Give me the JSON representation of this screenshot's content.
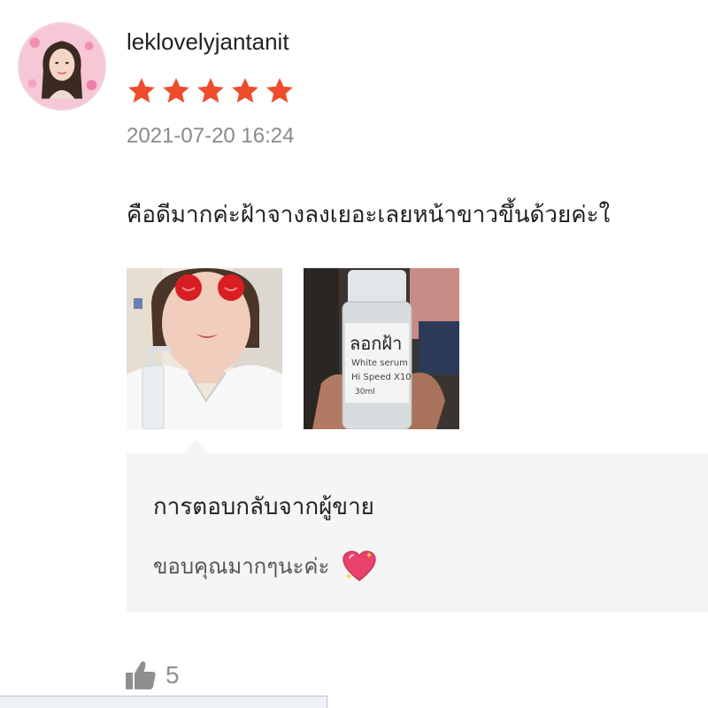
{
  "review": {
    "username": "leklovelyjantanit",
    "rating": 5,
    "rating_max": 5,
    "timestamp": "2021-07-20 16:24",
    "comment": "คือดีมากค่ะฝ้าจางลงเยอะเลยหน้าขาวขึ้นด้วยค่ะใ",
    "photos": [
      {
        "name": "review-photo-face"
      },
      {
        "name": "review-photo-bottle",
        "label_text": [
          "ลอกฝ้า",
          "White serum",
          "Hi Speed X10",
          "30ml"
        ]
      }
    ],
    "star_color": "#ee4d2d"
  },
  "seller_reply": {
    "title": "การตอบกลับจากผู้ขาย",
    "text": "ขอบคุณมากๆนะค่ะ",
    "icon": "sparkling-heart-icon"
  },
  "likes": {
    "icon": "thumbs-up-icon",
    "count": "5"
  },
  "colors": {
    "reply_bg": "#f5f5f5",
    "muted_text": "#8a8a8a"
  }
}
